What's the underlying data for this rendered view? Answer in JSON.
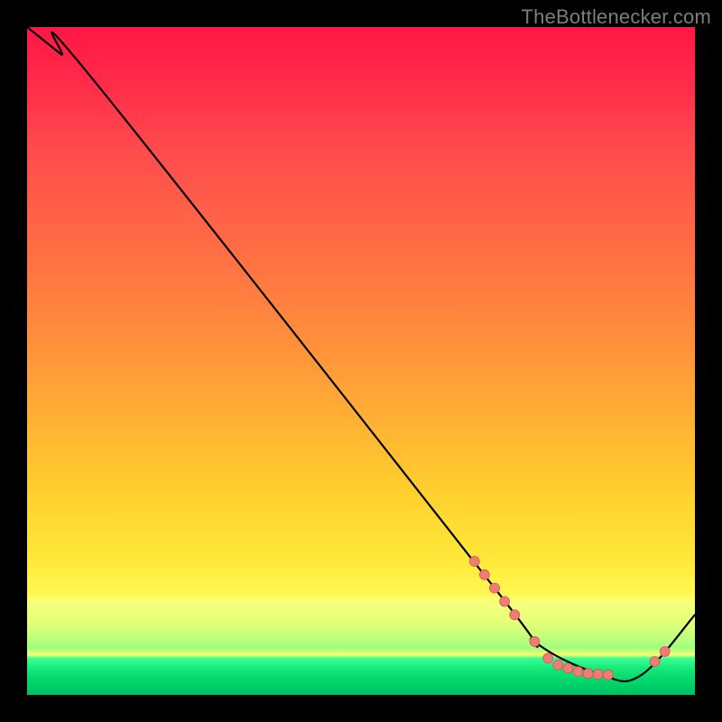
{
  "attribution": "TheBottlenecker.com",
  "colors": {
    "curve": "#000000",
    "dot_fill": "#ef7d75",
    "dot_stroke": "#d05c55"
  },
  "chart_data": {
    "type": "line",
    "title": "",
    "xlabel": "",
    "ylabel": "",
    "xlim": [
      0,
      100
    ],
    "ylim": [
      0,
      100
    ],
    "curve": {
      "x": [
        0,
        5,
        10,
        70,
        76,
        86,
        92,
        100
      ],
      "y": [
        100,
        96,
        92,
        16,
        8,
        3,
        3,
        12
      ]
    },
    "markers": {
      "x": [
        67,
        68.5,
        70,
        71.5,
        73,
        76,
        78,
        79.5,
        81,
        82.5,
        84,
        85.5,
        87,
        94,
        95.5
      ],
      "y": [
        20,
        18,
        16,
        14,
        12,
        8,
        5.5,
        4.5,
        4,
        3.5,
        3.2,
        3.1,
        3,
        5,
        6.5
      ]
    }
  }
}
